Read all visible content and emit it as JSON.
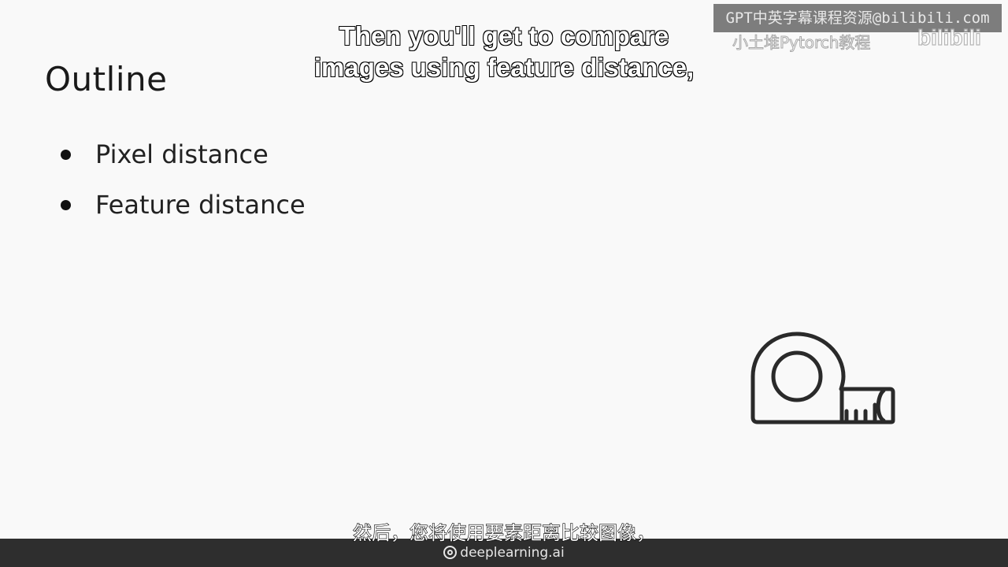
{
  "slide": {
    "title": "Outline",
    "bullets": [
      {
        "label": "Pixel distance"
      },
      {
        "label": "Feature distance"
      }
    ],
    "illustration": "tape-measure-icon"
  },
  "subtitles": {
    "english_line_1": "Then you'll get to compare",
    "english_line_2": "images using feature distance,",
    "chinese": "然后，您将使用要素距离比较图像，"
  },
  "watermark": {
    "line1": "GPT中英字幕课程资源@bilibili.com",
    "line2": "小土堆Pytorch教程",
    "logo": "bilibili"
  },
  "footer": {
    "brand": "deeplearning.ai",
    "brand_icon": "deeplearning-logo-icon"
  },
  "colors": {
    "background": "#f9f9f9",
    "text": "#1a1a1a",
    "footer_bar": "#2e2e2e"
  }
}
